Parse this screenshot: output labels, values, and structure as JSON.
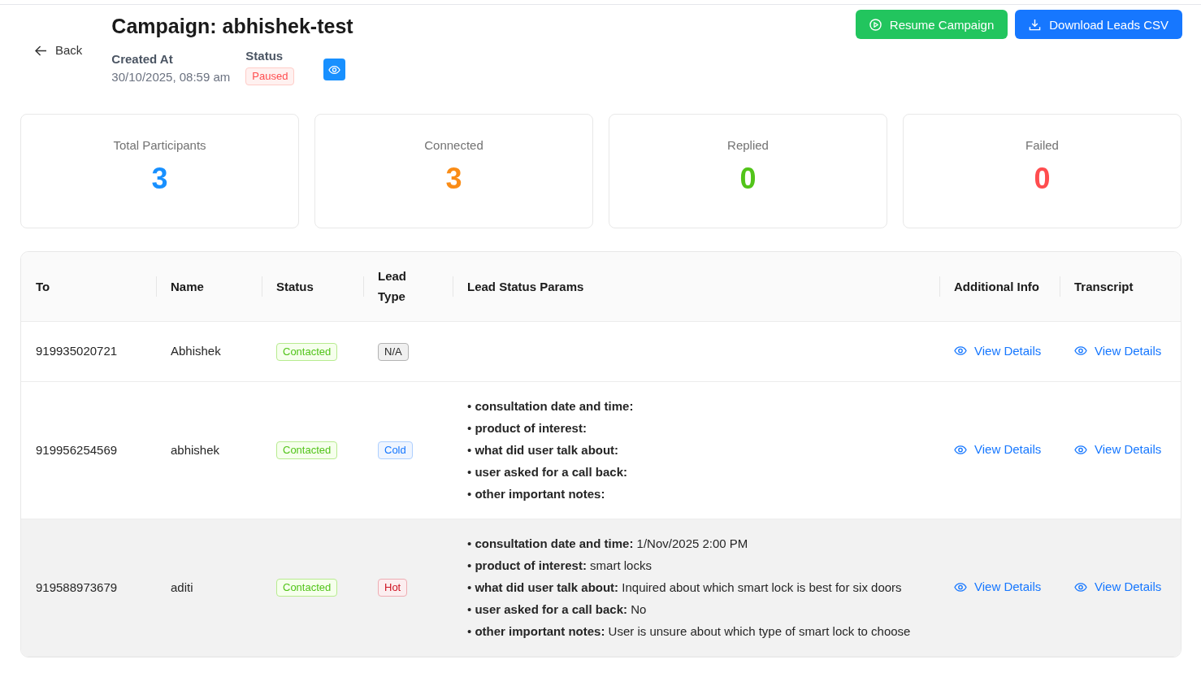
{
  "header": {
    "back": "Back",
    "title": "Campaign: abhishek-test",
    "created_at": {
      "label": "Created At",
      "value": "30/10/2025, 08:59 am"
    },
    "status": {
      "label": "Status",
      "value": "Paused"
    }
  },
  "actions": [
    {
      "label": "Resume Campaign",
      "kind": "resume"
    },
    {
      "label": "Download Leads CSV",
      "kind": "download"
    }
  ],
  "stats": [
    {
      "label": "Total Participants",
      "value": "3",
      "color": "#1890ff"
    },
    {
      "label": "Connected",
      "value": "3",
      "color": "#fa8c16"
    },
    {
      "label": "Replied",
      "value": "0",
      "color": "#52c41a"
    },
    {
      "label": "Failed",
      "value": "0",
      "color": "#ff4d4f"
    }
  ],
  "table": {
    "columns": [
      "To",
      "Name",
      "Status",
      "Lead Type",
      "Lead Status Params",
      "Additional Info",
      "Transcript"
    ],
    "rows": [
      {
        "to": "919935020721",
        "name": "Abhishek",
        "status": "Contacted",
        "lead_type": {
          "label": "N/A",
          "color": "#262626"
        },
        "additional_info": "View Details",
        "transcript": "View Details",
        "hovered": false
      },
      {
        "to": "919956254569",
        "name": "abhishek",
        "status": "Contacted",
        "lead_type": {
          "label": "Cold",
          "color": "#1677ff"
        },
        "lead_status_params": [
          "• **consultation date and time:**",
          "• **product of interest:**",
          "• **what did user talk about:**",
          "• **user asked for a call back:**",
          "• **other important notes:**"
        ],
        "additional_info": "View Details",
        "transcript": "View Details",
        "hovered": false
      },
      {
        "to": "919588973679",
        "name": "aditi",
        "status": "Contacted",
        "lead_type": {
          "label": "Hot",
          "color": "#cf1322"
        },
        "lead_status_params": [
          "• **consultation date and time:** 1/Nov/2025 2:00 PM",
          "• **product of interest:** smart locks",
          "• **what did user talk about:** Inquired about which smart lock is best for six doors",
          "• **user asked for a call back:** No",
          "• **other important notes:** User is unsure about which type of smart lock to choose"
        ],
        "additional_info": "View Details",
        "transcript": "View Details",
        "hovered": true
      }
    ]
  }
}
